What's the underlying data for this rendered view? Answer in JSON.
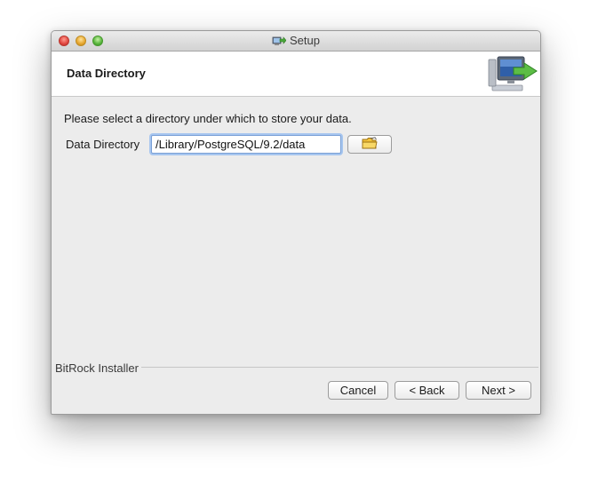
{
  "window": {
    "title": "Setup"
  },
  "header": {
    "title": "Data Directory"
  },
  "main": {
    "prompt": "Please select a directory under which to store your data.",
    "field_label": "Data Directory",
    "field_value": "/Library/PostgreSQL/9.2/data"
  },
  "footer": {
    "installer_label": "BitRock Installer",
    "cancel_label": "Cancel",
    "back_label": "< Back",
    "next_label": "Next >"
  },
  "icons": {
    "title_icon": "installer-icon",
    "header_logo": "computer-install-icon",
    "browse_icon": "folder-icon"
  },
  "colors": {
    "focus_ring": "#a7c6ef",
    "header_bg": "#ffffff",
    "window_bg": "#ececec"
  }
}
